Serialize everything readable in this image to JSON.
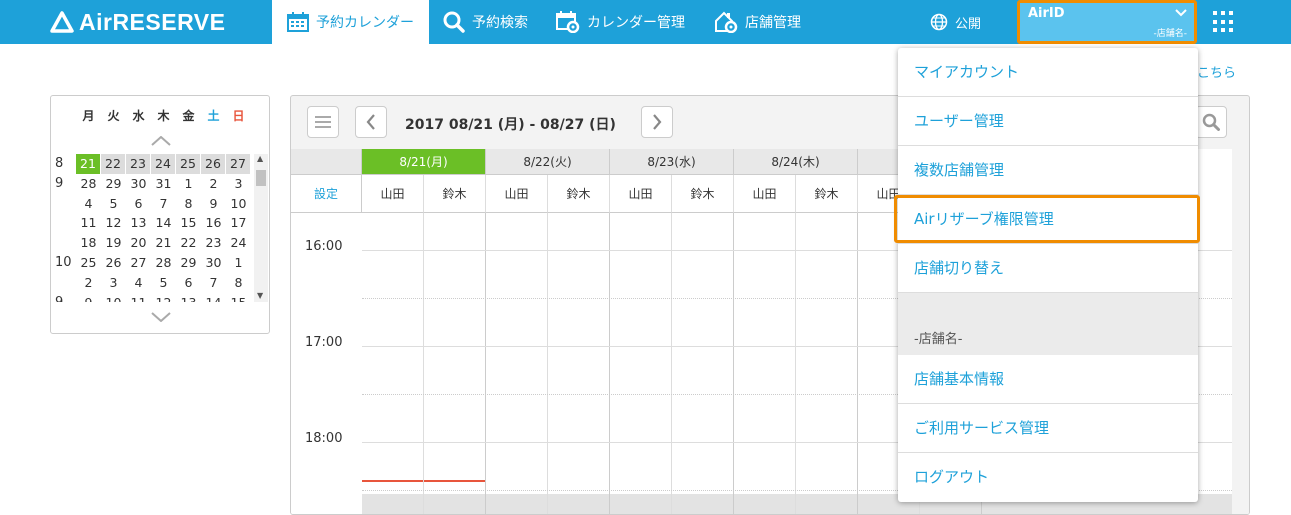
{
  "header": {
    "logo": "AirRESERVE",
    "nav": [
      {
        "label": "予約カレンダー",
        "active": true
      },
      {
        "label": "予約検索"
      },
      {
        "label": "カレンダー管理"
      },
      {
        "label": "店舗管理"
      }
    ],
    "public_label": "公開",
    "airid": {
      "name": "AirID",
      "store": "-店舗名-"
    }
  },
  "help_link": "はこちら",
  "mini_calendar": {
    "dow": [
      "月",
      "火",
      "水",
      "木",
      "金",
      "土",
      "日"
    ],
    "rows": [
      {
        "month": "8",
        "days": [
          "21",
          "22",
          "23",
          "24",
          "25",
          "26",
          "27"
        ],
        "highlight": true,
        "today_index": 0
      },
      {
        "month": "9",
        "days": [
          "28",
          "29",
          "30",
          "31",
          "1",
          "2",
          "3"
        ]
      },
      {
        "month": "",
        "days": [
          "4",
          "5",
          "6",
          "7",
          "8",
          "9",
          "10"
        ]
      },
      {
        "month": "",
        "days": [
          "11",
          "12",
          "13",
          "14",
          "15",
          "16",
          "17"
        ]
      },
      {
        "month": "",
        "days": [
          "18",
          "19",
          "20",
          "21",
          "22",
          "23",
          "24"
        ]
      },
      {
        "month": "10",
        "days": [
          "25",
          "26",
          "27",
          "28",
          "29",
          "30",
          "1"
        ]
      },
      {
        "month": "",
        "days": [
          "2",
          "3",
          "4",
          "5",
          "6",
          "7",
          "8"
        ]
      },
      {
        "month": "9",
        "days": [
          "9",
          "10",
          "11",
          "12",
          "13",
          "14",
          "15"
        ]
      }
    ]
  },
  "calendar": {
    "date_range": "2017 08/21 (月) - 08/27 (日)",
    "settings_label": "設定",
    "days": [
      {
        "label": "8/21(月)",
        "today": true
      },
      {
        "label": "8/22(火)"
      },
      {
        "label": "8/23(水)"
      },
      {
        "label": "8/24(木)"
      },
      {
        "label": "8"
      }
    ],
    "staff": [
      "山田",
      "鈴木"
    ],
    "last_staff_partial": [
      "山田",
      "木"
    ],
    "times": [
      "16:00",
      "17:00",
      "18:00"
    ]
  },
  "dropdown": {
    "items_top": [
      "マイアカウント",
      "ユーザー管理",
      "複数店舗管理",
      "Airリザーブ権限管理",
      "店舗切り替え"
    ],
    "section": "-店舗名-",
    "items_bottom": [
      "店舗基本情報",
      "ご利用サービス管理",
      "ログアウト"
    ]
  },
  "colors": {
    "brand": "#1ea1d9",
    "today": "#6bbf26",
    "highlight": "#f08c00",
    "now_line": "#e8553c"
  }
}
